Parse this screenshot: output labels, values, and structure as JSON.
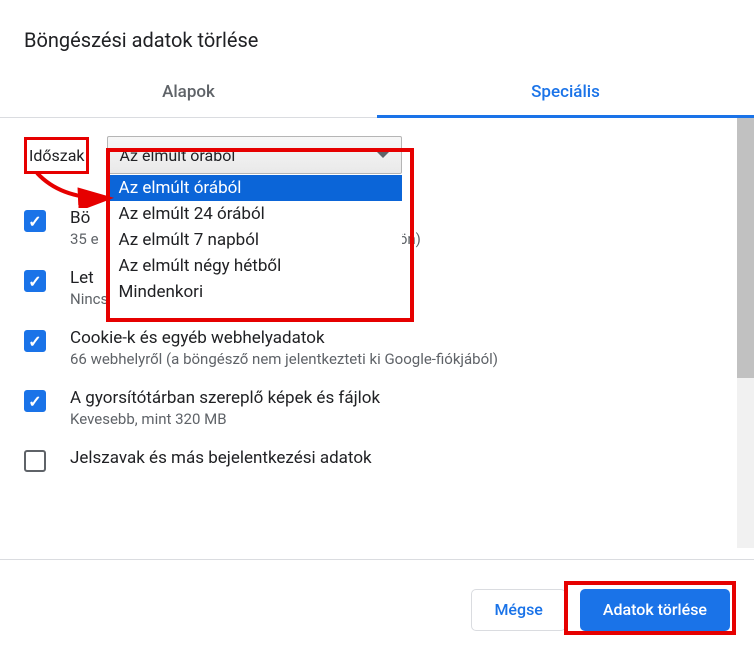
{
  "title": "Böngészési adatok törlése",
  "tabs": {
    "basic": "Alapok",
    "advanced": "Speciális"
  },
  "time": {
    "label": "Időszak",
    "selected": "Az elmúlt órából",
    "options": [
      "Az elmúlt órából",
      "Az elmúlt 24 órából",
      "Az elmúlt 7 napból",
      "Az elmúlt négy hétből",
      "Mindenkori"
    ]
  },
  "items": [
    {
      "checked": true,
      "title_prefix": "Bö",
      "title_suffix": "",
      "sub_prefix": "35 e",
      "sub_suffix": "szközökön)"
    },
    {
      "checked": true,
      "title_prefix": "Let",
      "title_suffix": "",
      "sub_prefix": "Nincs",
      "sub_suffix": ""
    },
    {
      "checked": true,
      "title": "Cookie-k és egyéb webhelyadatok",
      "sub": "66 webhelyről (a böngésző nem jelentkezteti ki Google-fiókjából)"
    },
    {
      "checked": true,
      "title": "A gyorsítótárban szereplő képek és fájlok",
      "sub": "Kevesebb, mint 320 MB"
    },
    {
      "checked": false,
      "title": "Jelszavak és más bejelentkezési adatok",
      "sub": ""
    }
  ],
  "buttons": {
    "cancel": "Mégse",
    "confirm": "Adatok törlése"
  }
}
